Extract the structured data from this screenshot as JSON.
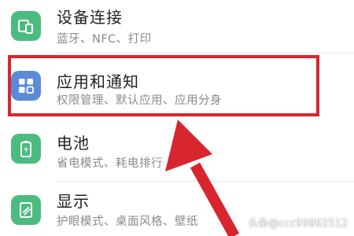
{
  "settings_items": [
    {
      "title": "设备连接",
      "subtitle": "蓝牙、NFC、打印",
      "icon": "device-connection-icon",
      "color": "#4cbb7f"
    },
    {
      "title": "应用和通知",
      "subtitle": "权限管理、默认应用、应用分身",
      "icon": "apps-grid-icon",
      "color": "#5b8bd6"
    },
    {
      "title": "电池",
      "subtitle": "省电模式、耗电排行",
      "icon": "battery-icon",
      "color": "#4cbb7f"
    },
    {
      "title": "显示",
      "subtitle": "护眼模式、桌面风格、壁纸",
      "icon": "display-icon",
      "color": "#4cbb7f"
    }
  ],
  "annotation": {
    "highlight_color": "#d8262f"
  },
  "watermark": {
    "text": "头条@ccc99992512"
  }
}
